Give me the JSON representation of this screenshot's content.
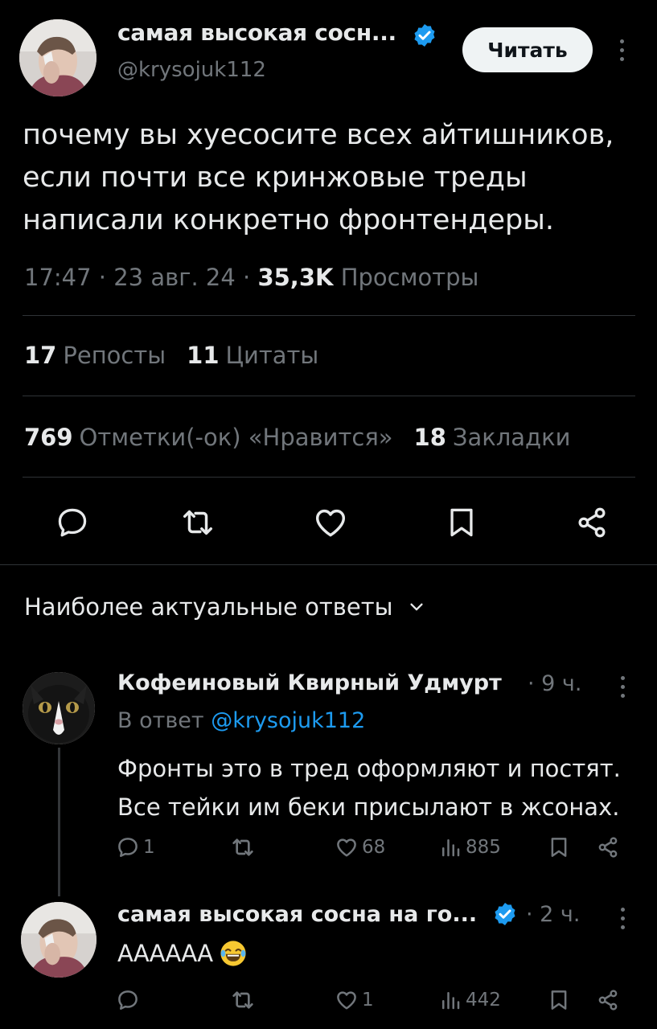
{
  "tweet": {
    "author_name": "самая высокая сосн...",
    "handle": "@krysojuk112",
    "follow_label": "Читать",
    "text": "почему вы хуесосите всех айтишников, если почти все кринжовые треды написали конкретно фронтендеры.",
    "time": "17:47",
    "date": "23 авг. 24",
    "views_count": "35,3K",
    "views_label": "Просмотры",
    "reposts_count": "17",
    "reposts_label": "Репосты",
    "quotes_count": "11",
    "quotes_label": "Цитаты",
    "likes_count": "769",
    "likes_label": "Отметки(-ок) «Нравится»",
    "bookmarks_count": "18",
    "bookmarks_label": "Закладки"
  },
  "replies_section": {
    "title": "Наиболее актуальные ответы"
  },
  "replies": [
    {
      "name": "Кофеиновый Квирный Удмурт",
      "time": "9 ч.",
      "reply_to_label": "В ответ",
      "reply_to_handle": "@krysojuk112",
      "text": "Фронты это в тред оформляют и постят. Все тейки им беки присылают в жсонах.",
      "replies": "1",
      "likes": "68",
      "views": "885"
    },
    {
      "name": "самая высокая сосна на го...",
      "time": "2 ч.",
      "text": "АААААА",
      "replies": "",
      "likes": "1",
      "views": "442"
    }
  ],
  "colors": {
    "background": "#000000",
    "text": "#e7e9ea",
    "secondary": "#71767b",
    "accent": "#1d9bf0",
    "divider": "#2f3336"
  },
  "icons": [
    "more-icon",
    "verified-icon",
    "reply-icon",
    "retweet-icon",
    "like-icon",
    "bookmark-icon",
    "share-icon",
    "views-icon",
    "chevron-down-icon",
    "laughing-emoji-icon"
  ]
}
